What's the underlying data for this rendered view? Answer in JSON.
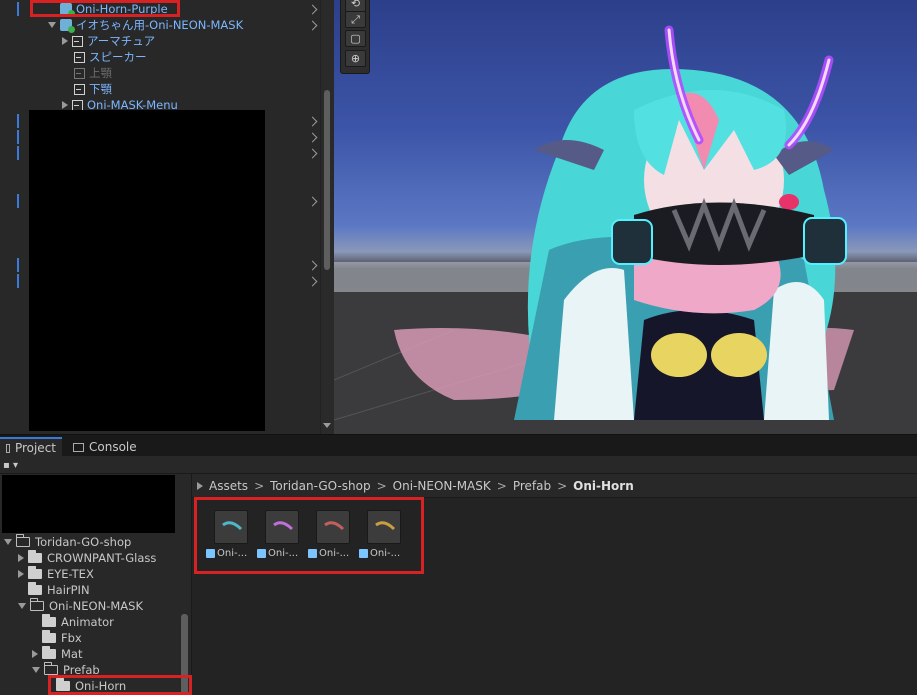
{
  "hierarchy": {
    "items": [
      {
        "label": "Oni-Horn-Purple",
        "icon": "prefab-icon",
        "expanded": false,
        "style": "blue"
      },
      {
        "label": "イオちゃん用-Oni-NEON-MASK",
        "icon": "prefab-icon",
        "expanded": true,
        "style": "blue"
      },
      {
        "label": "アーマチュア",
        "icon": "cube-icon",
        "style": "blue"
      },
      {
        "label": "スピーカー",
        "icon": "cube-icon",
        "style": "blue"
      },
      {
        "label": "上顎",
        "icon": "cube-icon",
        "style": "dim"
      },
      {
        "label": "下顎",
        "icon": "cube-icon",
        "style": "blue"
      },
      {
        "label": "Oni-MASK-Menu",
        "icon": "cube-icon",
        "style": "blue"
      }
    ]
  },
  "scene": {
    "tools": [
      "rotate-tool-icon",
      "scale-tool-icon",
      "rect-tool-icon",
      "transform-tool-icon"
    ]
  },
  "bottom": {
    "tabs": [
      {
        "label": "Project",
        "active": true
      },
      {
        "label": "Console",
        "active": false
      }
    ],
    "tree": [
      {
        "label": "Toridan-GO-shop",
        "expanded": true
      },
      {
        "label": "CROWNPANT-Glass",
        "expanded": false
      },
      {
        "label": "EYE-TEX",
        "expanded": false
      },
      {
        "label": "HairPIN"
      },
      {
        "label": "Oni-NEON-MASK",
        "expanded": true
      },
      {
        "label": "Animator"
      },
      {
        "label": "Fbx"
      },
      {
        "label": "Mat",
        "expanded": false
      },
      {
        "label": "Prefab",
        "expanded": true
      },
      {
        "label": "Oni-Horn"
      }
    ],
    "breadcrumb": [
      "Assets",
      "Toridan-GO-shop",
      "Oni-NEON-MASK",
      "Prefab",
      "Oni-Horn"
    ],
    "assets": [
      {
        "label": "Oni-...",
        "color": "#4fb8c8"
      },
      {
        "label": "Oni-...",
        "color": "#c070d8"
      },
      {
        "label": "Oni-...",
        "color": "#c26060"
      },
      {
        "label": "Oni-...",
        "color": "#c8a040"
      }
    ]
  },
  "colors": {
    "highlight": "#d62222",
    "accent": "#3a79d6",
    "neon_horn": "#b04cff",
    "hair": "#49d6d6"
  }
}
